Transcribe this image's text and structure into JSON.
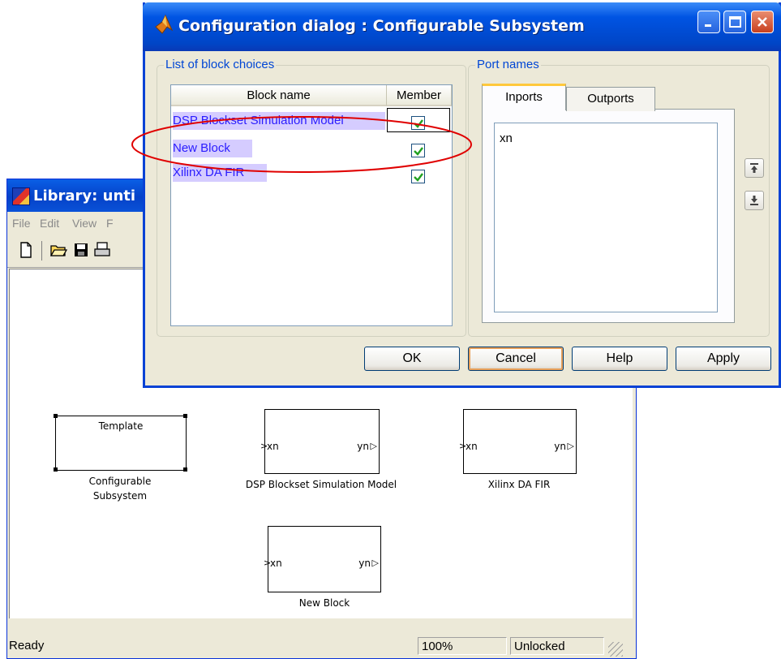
{
  "library_window": {
    "title": "Library: unti",
    "menu": [
      "File",
      "Edit",
      "View",
      "F"
    ],
    "toolbar_icons": [
      "new-document-icon",
      "open-folder-icon",
      "save-disk-icon",
      "print-icon"
    ],
    "blocks": {
      "configurable": {
        "inner_text": "Template",
        "caption_line1": "Configurable",
        "caption_line2": "Subsystem"
      },
      "dsp": {
        "in_port": "xn",
        "out_port": "yn",
        "caption": "DSP Blockset Simulation Model"
      },
      "xilinx": {
        "in_port": "xn",
        "out_port": "yn",
        "caption": "Xilinx DA FIR"
      },
      "new_block": {
        "in_port": "xn",
        "out_port": "yn",
        "caption": "New Block"
      }
    },
    "status": {
      "ready": "Ready",
      "zoom": "100%",
      "lock": "Unlocked"
    }
  },
  "dialog": {
    "title": "Configuration dialog : Configurable Subsystem",
    "block_choices": {
      "legend": "List of block choices",
      "col_name": "Block name",
      "col_member": "Member",
      "rows": [
        {
          "name": "DSP Blockset Simulation Model",
          "member": true
        },
        {
          "name": "New Block",
          "member": true
        },
        {
          "name": "Xilinx DA FIR",
          "member": true
        }
      ]
    },
    "port_names": {
      "legend": "Port names",
      "tabs": [
        "Inports",
        "Outports"
      ],
      "active_tab": "Inports",
      "inports_text": "xn"
    },
    "buttons": {
      "ok": "OK",
      "cancel": "Cancel",
      "help": "Help",
      "apply": "Apply"
    },
    "highlight_color": "#e00000"
  }
}
